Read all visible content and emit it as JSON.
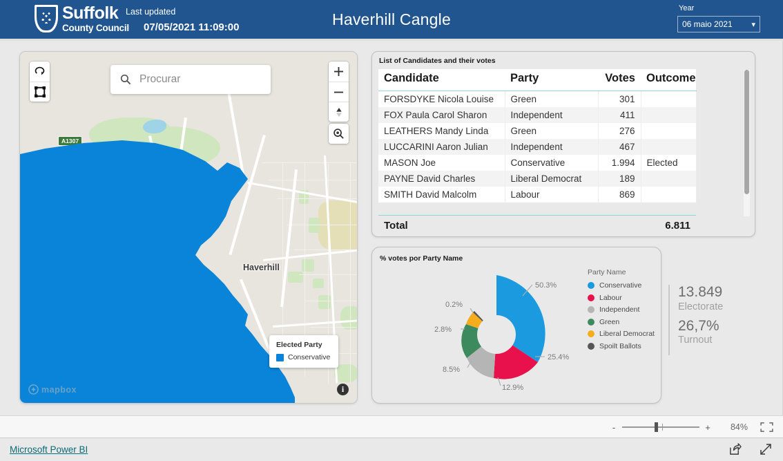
{
  "header": {
    "logo_main": "Suffolk",
    "logo_sub": "County Council",
    "crest_icon": "suffolk-crest-icon",
    "last_updated_label": "Last updated",
    "last_updated_value": "07/05/2021 11:09:00",
    "title": "Haverhill Cangle",
    "year_label": "Year",
    "year_value": "06 maio 2021",
    "chevron_icon": "chevron-down-icon",
    "bg_color": "#205590"
  },
  "map": {
    "search_placeholder": "Procurar",
    "search_icon": "search-icon",
    "lasso_select_icon": "lasso-select-icon",
    "rect_select_icon": "rectangle-select-icon",
    "zoom_in_icon": "plus-icon",
    "zoom_out_icon": "minus-icon",
    "compass_icon": "compass-icon",
    "find_icon": "magnifier-icon",
    "place_label": "Haverhill",
    "road_shield": "A1307",
    "legend_title": "Elected Party",
    "legend_item": "Conservative",
    "legend_color": "#0a84d8",
    "attribution": "mapbox",
    "attribution_icon": "mapbox-logo-icon",
    "info_icon": "info-icon",
    "polygon_color": "#0a84d8"
  },
  "table": {
    "title": "List of Candidates and their votes",
    "columns": [
      "Candidate",
      "Party",
      "Votes",
      "Outcome"
    ],
    "rows": [
      {
        "candidate": "FORSDYKE Nicola Louise",
        "party": "Green",
        "votes": "301",
        "outcome": ""
      },
      {
        "candidate": "FOX Paula Carol Sharon",
        "party": "Independent",
        "votes": "411",
        "outcome": ""
      },
      {
        "candidate": "LEATHERS Mandy Linda",
        "party": "Green",
        "votes": "276",
        "outcome": ""
      },
      {
        "candidate": "LUCCARINI Aaron Julian",
        "party": "Independent",
        "votes": "467",
        "outcome": ""
      },
      {
        "candidate": "MASON Joe",
        "party": "Conservative",
        "votes": "1.994",
        "outcome": "Elected"
      },
      {
        "candidate": "PAYNE David Charles",
        "party": "Liberal Democrat",
        "votes": "189",
        "outcome": ""
      },
      {
        "candidate": "SMITH David Malcolm",
        "party": "Labour",
        "votes": "869",
        "outcome": ""
      }
    ],
    "total_label": "Total",
    "total_value": "6.811"
  },
  "chart_data": {
    "type": "pie",
    "title": "% votes por Party Name",
    "legend_title": "Party Name",
    "legend_position": "right",
    "categories": [
      "Conservative",
      "Labour",
      "Independent",
      "Green",
      "Liberal Democrat",
      "Spoilt Ballots"
    ],
    "values": [
      50.3,
      25.4,
      12.9,
      8.5,
      2.8,
      0.2
    ],
    "labels": [
      "50.3%",
      "25.4%",
      "12.9%",
      "8.5%",
      "2.8%",
      "0.2%"
    ],
    "colors": [
      "#1b9ae0",
      "#e8114b",
      "#b5b5b5",
      "#3e8a5f",
      "#f5ad1d",
      "#565656"
    ],
    "xlabel": "",
    "ylabel": ""
  },
  "kpis": [
    {
      "value": "13.849",
      "label": "Electorate"
    },
    {
      "value": "26,7%",
      "label": "Turnout"
    }
  ],
  "status_bar": {
    "zoom_out_label": "-",
    "zoom_in_label": "+",
    "zoom_percent": "84%",
    "fit_icon": "fit-to-page-icon"
  },
  "footer": {
    "brand_link": "Microsoft Power BI",
    "share_icon": "share-icon",
    "fullscreen_icon": "fullscreen-icon"
  }
}
